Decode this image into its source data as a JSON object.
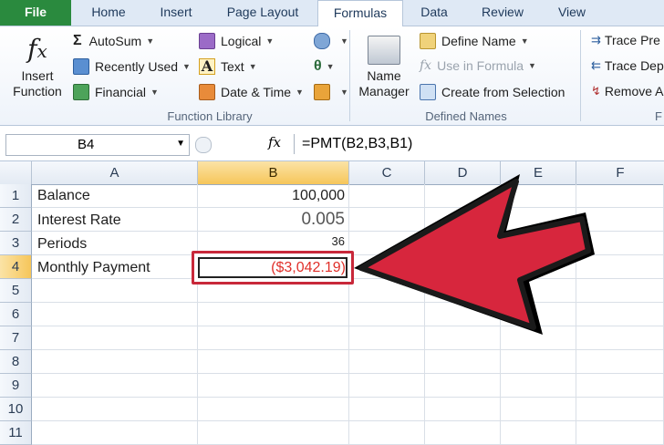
{
  "tabs": [
    {
      "label": "File",
      "kind": "file"
    },
    {
      "label": "Home"
    },
    {
      "label": "Insert"
    },
    {
      "label": "Page Layout"
    },
    {
      "label": "Formulas",
      "kind": "active"
    },
    {
      "label": "Data"
    },
    {
      "label": "Review"
    },
    {
      "label": "View"
    }
  ],
  "ribbon": {
    "insert_function": {
      "line1": "Insert",
      "line2": "Function",
      "icon": "fx-icon"
    },
    "function_library": {
      "label": "Function Library",
      "items": [
        {
          "label": "AutoSum",
          "icon": "sigma-icon"
        },
        {
          "label": "Recently Used",
          "icon": "star-book-icon"
        },
        {
          "label": "Financial",
          "icon": "financial-book-icon"
        },
        {
          "label": "Logical",
          "icon": "question-book-icon"
        },
        {
          "label": "Text",
          "icon": "text-a-icon"
        },
        {
          "label": "Date & Time",
          "icon": "clock-book-icon"
        }
      ]
    },
    "defined_names": {
      "label": "Defined Names",
      "name_manager": {
        "line1": "Name",
        "line2": "Manager"
      },
      "items": [
        {
          "label": "Define Name"
        },
        {
          "label": "Use in Formula",
          "disabled": true
        },
        {
          "label": "Create from Selection"
        }
      ]
    },
    "formula_auditing": {
      "label": "F",
      "items": [
        {
          "label": "Trace Pre"
        },
        {
          "label": "Trace Dep"
        },
        {
          "label": "Remove A"
        }
      ]
    }
  },
  "formula_bar": {
    "name_box": "B4",
    "fx": "fx",
    "formula": "=PMT(B2,B3,B1)"
  },
  "grid": {
    "columns": [
      "A",
      "B",
      "C",
      "D",
      "E",
      "F"
    ],
    "selected_column": "B",
    "selected_row": "4",
    "rows": [
      {
        "num": "1",
        "a": "Balance",
        "b": "100,000"
      },
      {
        "num": "2",
        "a": "Interest Rate",
        "b": "0.005"
      },
      {
        "num": "3",
        "a": "Periods",
        "b": "36"
      },
      {
        "num": "4",
        "a": "Monthly Payment",
        "b": "($3,042.19)"
      },
      {
        "num": "5",
        "a": "",
        "b": ""
      },
      {
        "num": "6",
        "a": "",
        "b": ""
      },
      {
        "num": "7",
        "a": "",
        "b": ""
      },
      {
        "num": "8",
        "a": "",
        "b": ""
      },
      {
        "num": "9",
        "a": "",
        "b": ""
      },
      {
        "num": "10",
        "a": "",
        "b": ""
      },
      {
        "num": "11",
        "a": "",
        "b": ""
      }
    ]
  },
  "colors": {
    "negative": "#e0302a",
    "highlight": "#d7263d",
    "file_tab": "#2a8a3e"
  }
}
